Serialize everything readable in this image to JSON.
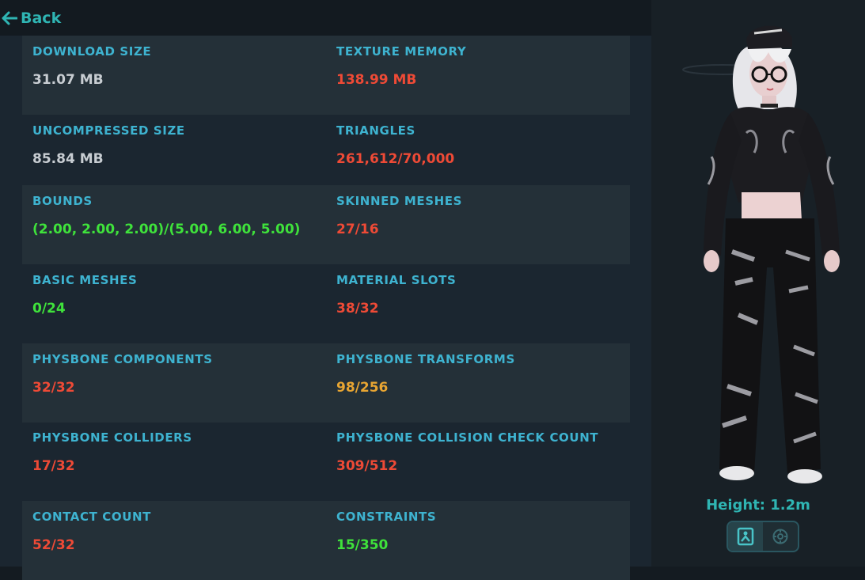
{
  "nav": {
    "back_label": "Back"
  },
  "stats": [
    {
      "left": {
        "label": "DOWNLOAD SIZE",
        "value": "31.07 MB",
        "color": "#c8cdd2"
      },
      "right": {
        "label": "TEXTURE MEMORY",
        "value": "138.99 MB",
        "color": "#ee4a36"
      }
    },
    {
      "left": {
        "label": "UNCOMPRESSED SIZE",
        "value": "85.84 MB",
        "color": "#c8cdd2"
      },
      "right": {
        "label": "TRIANGLES",
        "value": "261,612/70,000",
        "color": "#ee4a36"
      }
    },
    {
      "left": {
        "label": "BOUNDS",
        "value": "(2.00, 2.00, 2.00)/(5.00, 6.00, 5.00)",
        "color": "#3fe23b"
      },
      "right": {
        "label": "SKINNED MESHES",
        "value": "27/16",
        "color": "#ee4a36"
      }
    },
    {
      "left": {
        "label": "BASIC MESHES",
        "value": "0/24",
        "color": "#3fe23b"
      },
      "right": {
        "label": "MATERIAL SLOTS",
        "value": "38/32",
        "color": "#ee4a36"
      }
    },
    {
      "left": {
        "label": "PHYSBONE COMPONENTS",
        "value": "32/32",
        "color": "#ee4a36"
      },
      "right": {
        "label": "PHYSBONE TRANSFORMS",
        "value": "98/256",
        "color": "#e8a532"
      }
    },
    {
      "left": {
        "label": "PHYSBONE COLLIDERS",
        "value": "17/32",
        "color": "#ee4a36"
      },
      "right": {
        "label": "PHYSBONE COLLISION CHECK COUNT",
        "value": "309/512",
        "color": "#ee4a36"
      }
    },
    {
      "left": {
        "label": "CONTACT COUNT",
        "value": "52/32",
        "color": "#ee4a36"
      },
      "right": {
        "label": "CONSTRAINTS",
        "value": "15/350",
        "color": "#3fe23b"
      }
    }
  ],
  "preview": {
    "height_label": "Height: 1.2m",
    "view_toggle": {
      "selected": "avatar-view",
      "icons": [
        "avatar-view-icon",
        "settings-view-icon"
      ]
    }
  },
  "colors": {
    "accent": "#2fb5b3",
    "label": "#3eb3d0",
    "bad": "#ee4a36",
    "good": "#3fe23b",
    "warn": "#e8a532"
  }
}
